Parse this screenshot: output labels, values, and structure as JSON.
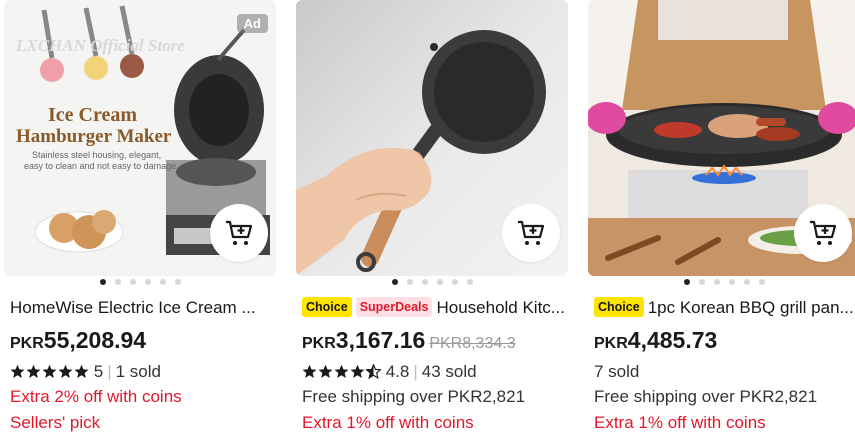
{
  "products": [
    {
      "badge": "Ad",
      "image_text": {
        "watermark": "LXCHAN Official Store",
        "headline1": "Ice Cream",
        "headline2": "Hamburger Maker",
        "sub1": "Stainless steel housing, elegant,",
        "sub2": "easy to clean and not easy to damage."
      },
      "title": "HomeWise Electric Ice Cream ...",
      "currency": "PKR",
      "price": "55,208.94",
      "rating": "5",
      "stars": 5,
      "sold": "1 sold",
      "line2": "Extra 2% off with coins",
      "line3": "Sellers' pick"
    },
    {
      "tags": {
        "choice": "Choice",
        "super": "SuperDeals"
      },
      "title": "Household Kitc...",
      "currency": "PKR",
      "price": "3,167.16",
      "old_price": "PKR8,334.3",
      "rating": "4.8",
      "stars": 4.5,
      "sold": "43 sold",
      "line2": "Free shipping over PKR2,821",
      "line3": "Extra 1% off with coins"
    },
    {
      "tags": {
        "choice": "Choice"
      },
      "title": "1pc Korean BBQ grill pan...",
      "currency": "PKR",
      "price": "4,485.73",
      "sold": "7 sold",
      "line2": "Free shipping over PKR2,821",
      "line3": "Extra 1% off with coins"
    }
  ],
  "colors": {
    "accent_red": "#e2182a",
    "choice_yellow": "#ffe400"
  },
  "icons": {
    "cart": "add-to-cart-icon",
    "star": "star-icon"
  }
}
